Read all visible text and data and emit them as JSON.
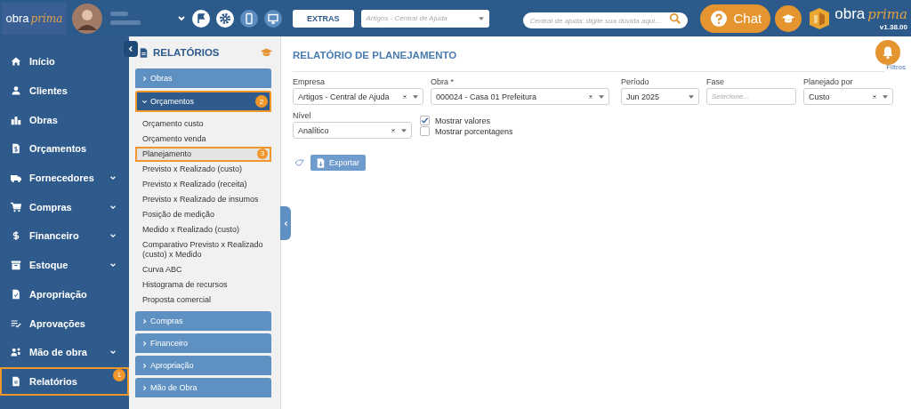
{
  "header": {
    "logo": {
      "word1": "obra",
      "word2": "prima"
    },
    "extras_button": "EXTRAS",
    "help_select": {
      "placeholder": "Artigos - Central de Ajuda"
    },
    "help_search": {
      "placeholder": "Central de ajuda: digite sua dúvida aqui..."
    },
    "chat_button": "Chat",
    "brand": {
      "word1": "obra",
      "word2": "prima",
      "version": "v1.38.00"
    }
  },
  "sidebar": {
    "items": [
      {
        "label": "Início",
        "expandable": false,
        "selected": false
      },
      {
        "label": "Clientes",
        "expandable": false,
        "selected": false
      },
      {
        "label": "Obras",
        "expandable": false,
        "selected": false
      },
      {
        "label": "Orçamentos",
        "expandable": false,
        "selected": false
      },
      {
        "label": "Fornecedores",
        "expandable": true,
        "selected": false
      },
      {
        "label": "Compras",
        "expandable": true,
        "selected": false
      },
      {
        "label": "Financeiro",
        "expandable": true,
        "selected": false
      },
      {
        "label": "Estoque",
        "expandable": true,
        "selected": false
      },
      {
        "label": "Apropriação",
        "expandable": false,
        "selected": false
      },
      {
        "label": "Aprovações",
        "expandable": false,
        "selected": false
      },
      {
        "label": "Mão de obra",
        "expandable": true,
        "selected": false
      },
      {
        "label": "Relatórios",
        "expandable": false,
        "selected": true,
        "callout": "1"
      }
    ]
  },
  "reports_panel": {
    "title": "RELATÓRIOS",
    "sections": [
      {
        "label": "Obras",
        "expanded": false
      },
      {
        "label": "Orçamentos",
        "expanded": true,
        "callout": "2",
        "items": [
          {
            "label": "Orçamento custo",
            "selected": false
          },
          {
            "label": "Orçamento venda",
            "selected": false
          },
          {
            "label": "Planejamento",
            "selected": true,
            "callout": "3"
          },
          {
            "label": "Previsto x Realizado (custo)",
            "selected": false
          },
          {
            "label": "Previsto x Realizado (receita)",
            "selected": false
          },
          {
            "label": "Previsto x Realizado de insumos",
            "selected": false
          },
          {
            "label": "Posição de medição",
            "selected": false
          },
          {
            "label": "Medido x Realizado (custo)",
            "selected": false
          },
          {
            "label": "Comparativo Previsto x Realizado (custo) x Medido",
            "selected": false
          },
          {
            "label": "Curva ABC",
            "selected": false
          },
          {
            "label": "Histograma de recursos",
            "selected": false
          },
          {
            "label": "Proposta comercial",
            "selected": false
          }
        ]
      },
      {
        "label": "Compras",
        "expanded": false
      },
      {
        "label": "Financeiro",
        "expanded": false
      },
      {
        "label": "Apropriação",
        "expanded": false
      },
      {
        "label": "Mão de Obra",
        "expanded": false
      }
    ]
  },
  "main": {
    "title": "RELATÓRIO DE PLANEJAMENTO",
    "filters_link": "Filtros",
    "fields": [
      {
        "label": "Empresa",
        "value": "Artigos - Central de Ajuda",
        "clearable": true,
        "dropdown": true
      },
      {
        "label": "Obra *",
        "value": "000024 - Casa 01 Prefeitura",
        "clearable": true,
        "dropdown": true
      },
      {
        "label": "Período",
        "value": "Jun 2025",
        "clearable": false,
        "dropdown": true
      },
      {
        "label": "Fase",
        "placeholder": "Selecione...",
        "clearable": false,
        "dropdown": false
      },
      {
        "label": "Planejado por",
        "value": "Custo",
        "clearable": true,
        "dropdown": true
      },
      {
        "label": "Nível",
        "value": "Analítico",
        "clearable": true,
        "dropdown": true
      }
    ],
    "options": [
      {
        "label": "Mostrar valores",
        "checked": true
      },
      {
        "label": "Mostrar porcentagens",
        "checked": false
      }
    ],
    "export_button": "Exportar"
  }
}
